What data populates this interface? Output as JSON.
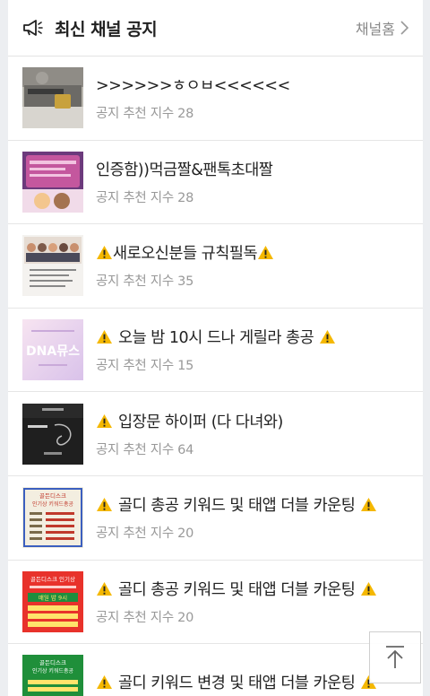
{
  "header": {
    "icon": "megaphone-icon",
    "title": "최신 채널 공지",
    "more_label": "채널홈",
    "more_icon": "chevron-right-icon"
  },
  "meta_prefix": "공지 추천 지수",
  "posts": [
    {
      "title": ">>>>>>ㅎㅇㅂ<<<<<<",
      "score": "공지 추천 지수 28",
      "warn_left": false,
      "warn_right": false
    },
    {
      "title": "인증함))먹금짤&팬톡초대짤",
      "score": "공지 추천 지수 28",
      "warn_left": false,
      "warn_right": false
    },
    {
      "title": "새로오신분들 규칙필독",
      "score": "공지 추천 지수 35",
      "warn_left": true,
      "warn_right": true
    },
    {
      "title": "오늘 밤 10시 드나 게릴라 총공",
      "score": "공지 추천 지수 15",
      "warn_left": true,
      "warn_right": true
    },
    {
      "title": "입장문 하이퍼 (다 다녀와)",
      "score": "공지 추천 지수 64",
      "warn_left": true,
      "warn_right": false
    },
    {
      "title": "골디 총공 키워드 및 태앱 더블 카운팅",
      "score": "공지 추천 지수 20",
      "warn_left": true,
      "warn_right": true
    },
    {
      "title": "골디 총공 키워드 및 태앱 더블 카운팅",
      "score": "공지 추천 지수 20",
      "warn_left": true,
      "warn_right": true
    },
    {
      "title": "골디 키워드 변경 및 태앱 더블 카운팅",
      "score": "",
      "warn_left": true,
      "warn_right": true
    }
  ],
  "thumb_text": {
    "t4": "DNA뮤스",
    "t6_line1": "골든디스크",
    "t6_line2": "인기상 키워드총공",
    "t7_line1": "골든디스크 인기상",
    "t7_line2": "매일 밤 9시",
    "t8_line1": "골든디스크",
    "t8_line2": "인기상 키워드총공"
  },
  "scroll_top_icon": "arrow-up-icon",
  "colors": {
    "warning_fill": "#f5b800",
    "meta_text": "#999999",
    "divider": "#e6e6e6"
  }
}
